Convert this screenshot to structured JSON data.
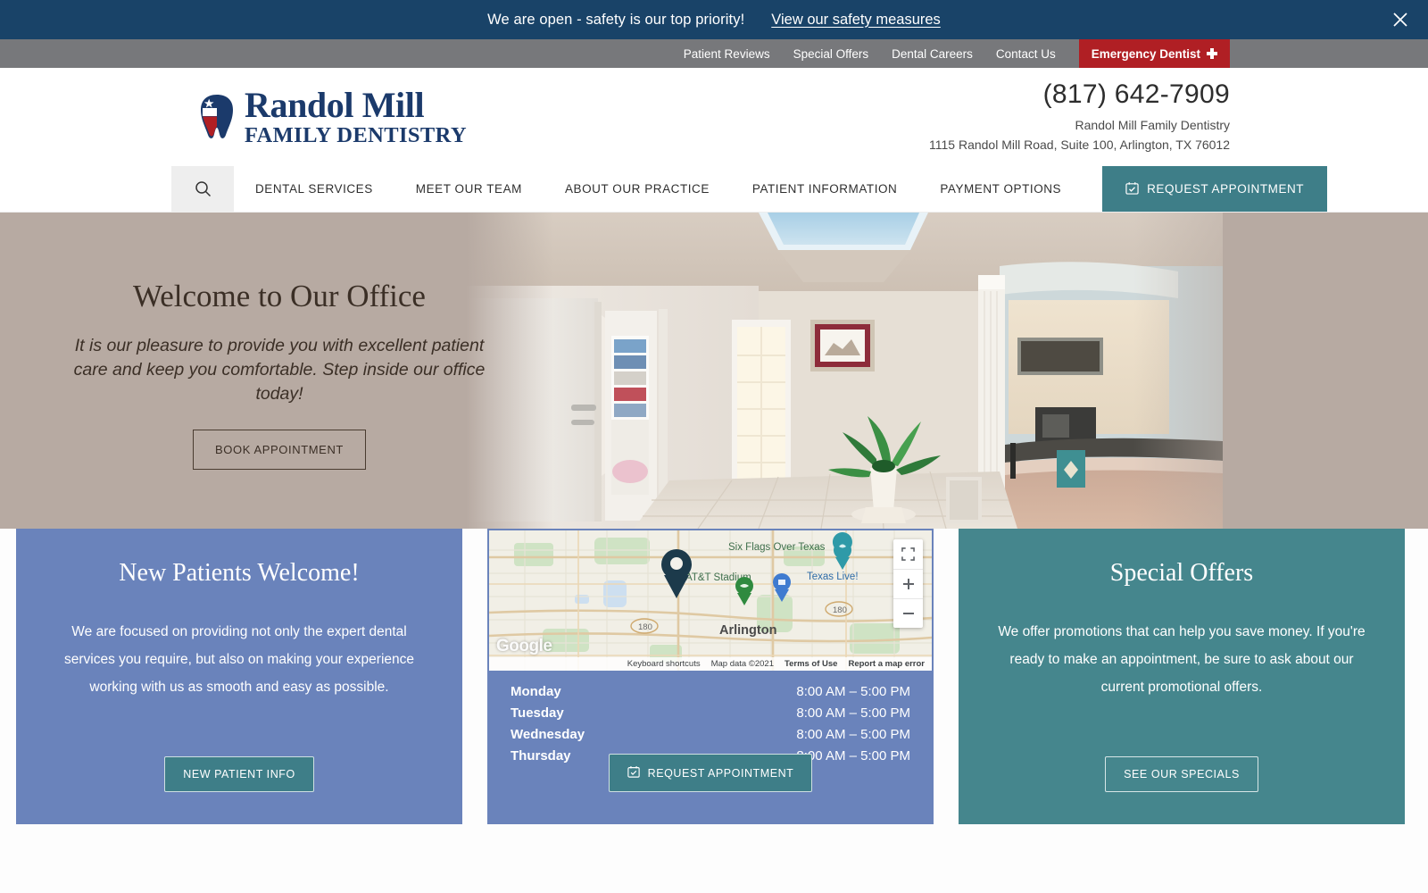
{
  "alert": {
    "message": "We are open - safety is our top priority!",
    "link_label": "View our safety measures",
    "close_icon": "close-icon",
    "bg_color": "#194368"
  },
  "utility_nav": {
    "items": [
      {
        "label": "Patient Reviews"
      },
      {
        "label": "Special Offers"
      },
      {
        "label": "Dental Careers"
      },
      {
        "label": "Contact Us"
      }
    ],
    "emergency": {
      "label": "Emergency Dentist",
      "icon": "medical-cross-icon",
      "bg_color": "#b01f24"
    },
    "bg_color": "#77787b"
  },
  "header": {
    "logo": {
      "line1": "Randol Mill",
      "line2": "FAMILY DENTISTRY",
      "icon": "texas-flag-tooth-icon",
      "color": "#1b3a6b"
    },
    "phone": "(817) 642-7909",
    "practice_name": "Randol Mill Family Dentistry",
    "address": "1115 Randol Mill Road, Suite 100, Arlington, TX 76012"
  },
  "main_nav": {
    "search_icon": "search-icon",
    "items": [
      {
        "label": "DENTAL SERVICES"
      },
      {
        "label": "MEET OUR TEAM"
      },
      {
        "label": "ABOUT OUR PRACTICE"
      },
      {
        "label": "PATIENT INFORMATION"
      },
      {
        "label": "PAYMENT OPTIONS"
      }
    ],
    "cta": {
      "label": "REQUEST APPOINTMENT",
      "icon": "calendar-check-icon",
      "bg_color": "#3e7e88"
    }
  },
  "hero": {
    "title": "Welcome to Our Office",
    "subtitle": "It is our pleasure to provide you with excellent patient care and keep you comfortable. Step inside our office today!",
    "button_label": "BOOK APPOINTMENT",
    "bg_color": "#b7aaa2",
    "image_alt": "dental-office-reception-interior"
  },
  "cards": {
    "new_patients": {
      "title": "New Patients Welcome!",
      "body": "We are focused on providing not only the expert dental services you require, but also on making your experience working with us as smooth and easy as possible.",
      "button_label": "NEW PATIENT INFO",
      "bg_color": "#6a83bb"
    },
    "location": {
      "map": {
        "labels": [
          {
            "text": "Six Flags Over Texas"
          },
          {
            "text": "AT&T Stadium"
          },
          {
            "text": "Texas Live!"
          },
          {
            "text": "Arlington"
          }
        ],
        "route_shields": [
          "180",
          "180"
        ],
        "attribution": {
          "brand": "Google",
          "keyboard_shortcuts": "Keyboard shortcuts",
          "map_data": "Map data ©2021",
          "terms": "Terms of Use",
          "report": "Report a map error"
        },
        "controls": {
          "fullscreen_icon": "fullscreen-icon",
          "zoom_in_icon": "plus-icon",
          "zoom_out_icon": "minus-icon"
        }
      },
      "hours": [
        {
          "day": "Monday",
          "time": "8:00 AM – 5:00 PM"
        },
        {
          "day": "Tuesday",
          "time": "8:00 AM – 5:00 PM"
        },
        {
          "day": "Wednesday",
          "time": "8:00 AM – 5:00 PM"
        },
        {
          "day": "Thursday",
          "time": "8:00 AM – 5:00 PM"
        }
      ],
      "button_label": "REQUEST APPOINTMENT",
      "button_icon": "calendar-check-icon",
      "bg_color": "#6a83bb"
    },
    "special_offers": {
      "title": "Special Offers",
      "body": "We offer promotions that can help you save money. If you're ready to make an appointment, be sure to ask about our current promotional offers.",
      "button_label": "SEE OUR SPECIALS",
      "bg_color": "#45868d"
    }
  }
}
